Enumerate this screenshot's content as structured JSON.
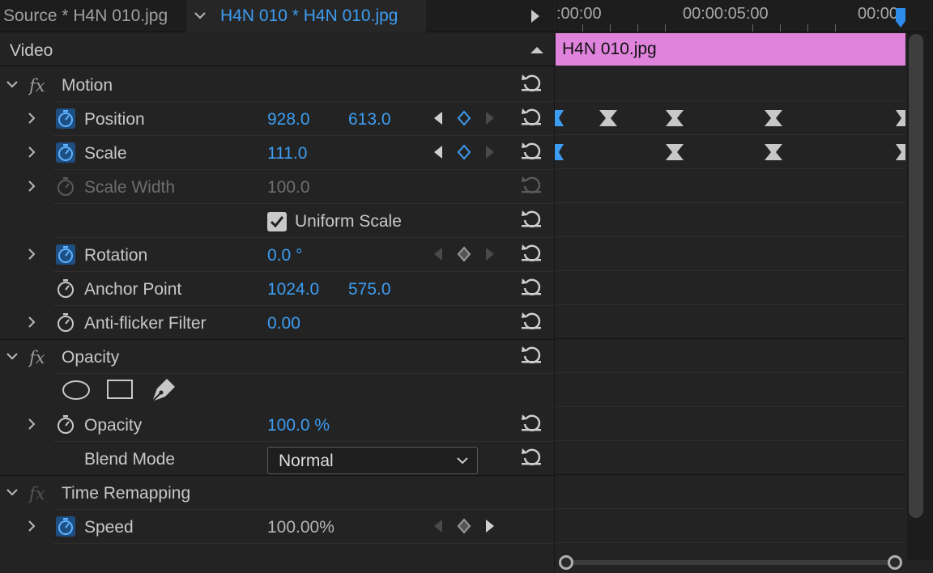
{
  "tabs": {
    "source": "Source * H4N 010.jpg",
    "active": "H4N 010 * H4N 010.jpg"
  },
  "ruler": {
    "timecodes": [
      ":00:00",
      "00:00:05:00",
      "00:00"
    ]
  },
  "section": {
    "title": "Video"
  },
  "clip": {
    "name": "H4N 010.jpg",
    "color": "#e083dd"
  },
  "effects": {
    "motion": {
      "title": "Motion",
      "position": {
        "label": "Position",
        "x": "928.0",
        "y": "613.0"
      },
      "scale": {
        "label": "Scale",
        "value": "111.0"
      },
      "scale_width": {
        "label": "Scale Width",
        "value": "100.0"
      },
      "uniform_scale": {
        "label": "Uniform Scale",
        "checked": true
      },
      "rotation": {
        "label": "Rotation",
        "value": "0.0 °"
      },
      "anchor_point": {
        "label": "Anchor Point",
        "x": "1024.0",
        "y": "575.0"
      },
      "anti_flicker": {
        "label": "Anti-flicker Filter",
        "value": "0.00"
      }
    },
    "opacity": {
      "title": "Opacity",
      "opacity": {
        "label": "Opacity",
        "value": "100.0 %"
      },
      "blend_mode": {
        "label": "Blend Mode",
        "value": "Normal"
      }
    },
    "time_remapping": {
      "title": "Time Remapping",
      "speed": {
        "label": "Speed",
        "value": "100.00%"
      }
    }
  },
  "colors": {
    "accent": "#3d9df2",
    "clip": "#e083dd",
    "background": "#232323"
  }
}
